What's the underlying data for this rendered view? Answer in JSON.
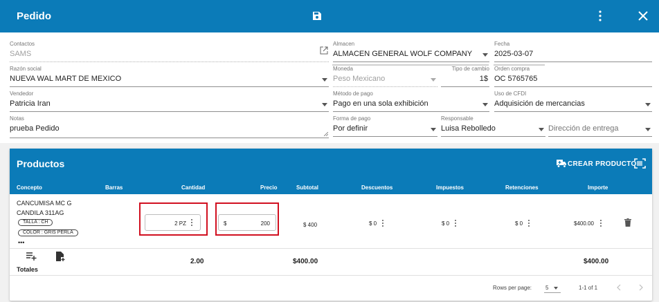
{
  "appbar": {
    "title": "Pedido"
  },
  "form": {
    "contactos": {
      "label": "Contactos",
      "value": "SAMS"
    },
    "razon": {
      "label": "Razón social",
      "value": "NUEVA WAL MART DE MEXICO"
    },
    "vendedor": {
      "label": "Vendedor",
      "value": "Patricia Iran"
    },
    "notas": {
      "label": "Notas",
      "value": "prueba Pedido"
    },
    "almacen": {
      "label": "Almacen",
      "value": "ALMACEN GENERAL WOLF COMPANY"
    },
    "moneda": {
      "label": "Moneda",
      "value": "Peso Mexicano"
    },
    "tipo_cambio": {
      "label": "Tipo de cambio",
      "value": "1$"
    },
    "metodo_pago": {
      "label": "Método de pago",
      "value": "Pago en una sola exhibición"
    },
    "forma_pago": {
      "label": "Forma de pago",
      "value": "Por definir"
    },
    "responsable": {
      "label": "Responsable",
      "value": "Luisa Rebolledo"
    },
    "fecha": {
      "label": "Fecha",
      "value": "2025-03-07"
    },
    "orden_compra": {
      "label": "Orden compra",
      "value": "OC  5765765"
    },
    "uso_cfdi": {
      "label": "Uso de CFDI",
      "value": "Adquisición de mercancias"
    },
    "direccion": {
      "placeholder": "Dirección de entrega"
    }
  },
  "products": {
    "title": "Productos",
    "create_label": "CREAR PRODUCTO",
    "columns": [
      "Concepto",
      "Barras",
      "Cantidad",
      "Precio",
      "Subtotal",
      "Descuentos",
      "Impuestos",
      "Retenciones",
      "Importe"
    ],
    "row": {
      "line1": "CANCUMISA MC G",
      "line2": "CANDILA 311AG",
      "chip_talla": "TALLA : CH",
      "chip_color": "COLOR : GRIS PERLA",
      "more": "•••",
      "cantidad": "2 PZ",
      "precio_symbol": "$",
      "precio": "200",
      "subtotal": "$ 400",
      "descuentos": "$ 0",
      "impuestos": "$ 0",
      "retenciones": "$ 0",
      "importe": "$400.00"
    },
    "totals": {
      "label": "Totales",
      "cantidad": "2.00",
      "subtotal": "$400.00",
      "importe": "$400.00"
    },
    "pagination": {
      "rows_label": "Rows per page:",
      "rows_value": "5",
      "range": "1-1 of 1"
    }
  },
  "colors": {
    "primary": "#0b7bb8",
    "highlight": "#d10f1f"
  }
}
